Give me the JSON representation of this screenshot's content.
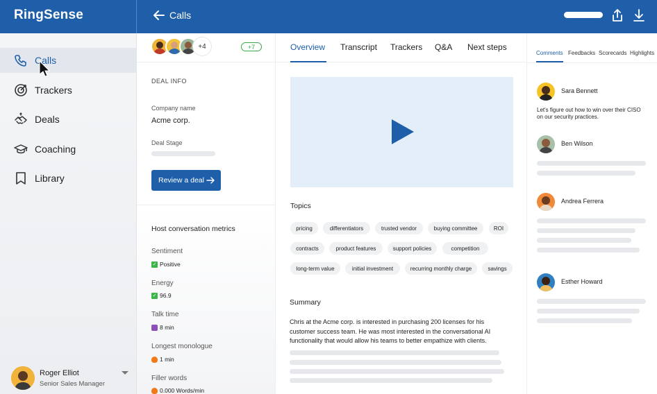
{
  "app": {
    "name": "RingSense",
    "page_title": "Calls"
  },
  "colors": {
    "brand": "#1f5faa",
    "video_bg": "#e4eef8",
    "play": "#1f5faa",
    "positive": "#3bb54a"
  },
  "topbar": {
    "icons": [
      "back-arrow-icon",
      "share-icon",
      "download-icon"
    ]
  },
  "sidebar": {
    "items": [
      {
        "label": "Calls",
        "icon": "phone-icon",
        "active": true
      },
      {
        "label": "Trackers",
        "icon": "target-icon"
      },
      {
        "label": "Deals",
        "icon": "handshake-icon"
      },
      {
        "label": "Coaching",
        "icon": "graduation-cap-icon"
      },
      {
        "label": "Library",
        "icon": "bookmark-icon"
      }
    ],
    "user": {
      "name": "Roger Elliot",
      "role": "Senior Sales Manager"
    }
  },
  "deal": {
    "participants_more": "+4",
    "badge": "+7",
    "section_title": "DEAL INFO",
    "company_label": "Company name",
    "company_value": "Acme corp.",
    "stage_label": "Deal Stage",
    "review_button": "Review a deal"
  },
  "metrics": {
    "title": "Host conversation metrics",
    "items": [
      {
        "label": "Sentiment",
        "value": "Positive",
        "icon": "check-icon"
      },
      {
        "label": "Energy",
        "value": "96.9",
        "icon": "check-icon"
      },
      {
        "label": "Talk time",
        "value": "8 min",
        "icon": "devil-icon"
      },
      {
        "label": "Longest monologue",
        "value": "1 min",
        "icon": "fire-icon"
      },
      {
        "label": "Filler words",
        "value": "0.000 Words/min",
        "icon": "fire-icon"
      }
    ]
  },
  "tabs": [
    "Overview",
    "Transcript",
    "Trackers",
    "Q&A",
    "Next steps"
  ],
  "topics": {
    "heading": "Topics",
    "chips": [
      "pricing",
      "differentiators",
      "trusted vendor",
      "buying committee",
      "ROI",
      "contracts",
      "product features",
      "support policies",
      "competition",
      "long-term value",
      "initial investment",
      "recurring monthly charge",
      "savings"
    ]
  },
  "summary": {
    "heading": "Summary",
    "text": "Chris at the Acme corp. is interested in purchasing 200 licenses for his customer success team. He was most interested in the conversational AI functionality that would allow his teams to better empathize with clients."
  },
  "right_tabs": [
    "Comments",
    "Feedbacks",
    "Scorecards",
    "Highlights"
  ],
  "comments": [
    {
      "name": "Sara Bennett",
      "text": "Let's figure out how to win over their CISO on our security practices."
    },
    {
      "name": "Ben Wilson"
    },
    {
      "name": "Andrea Ferrera"
    },
    {
      "name": "Esther Howard"
    }
  ]
}
